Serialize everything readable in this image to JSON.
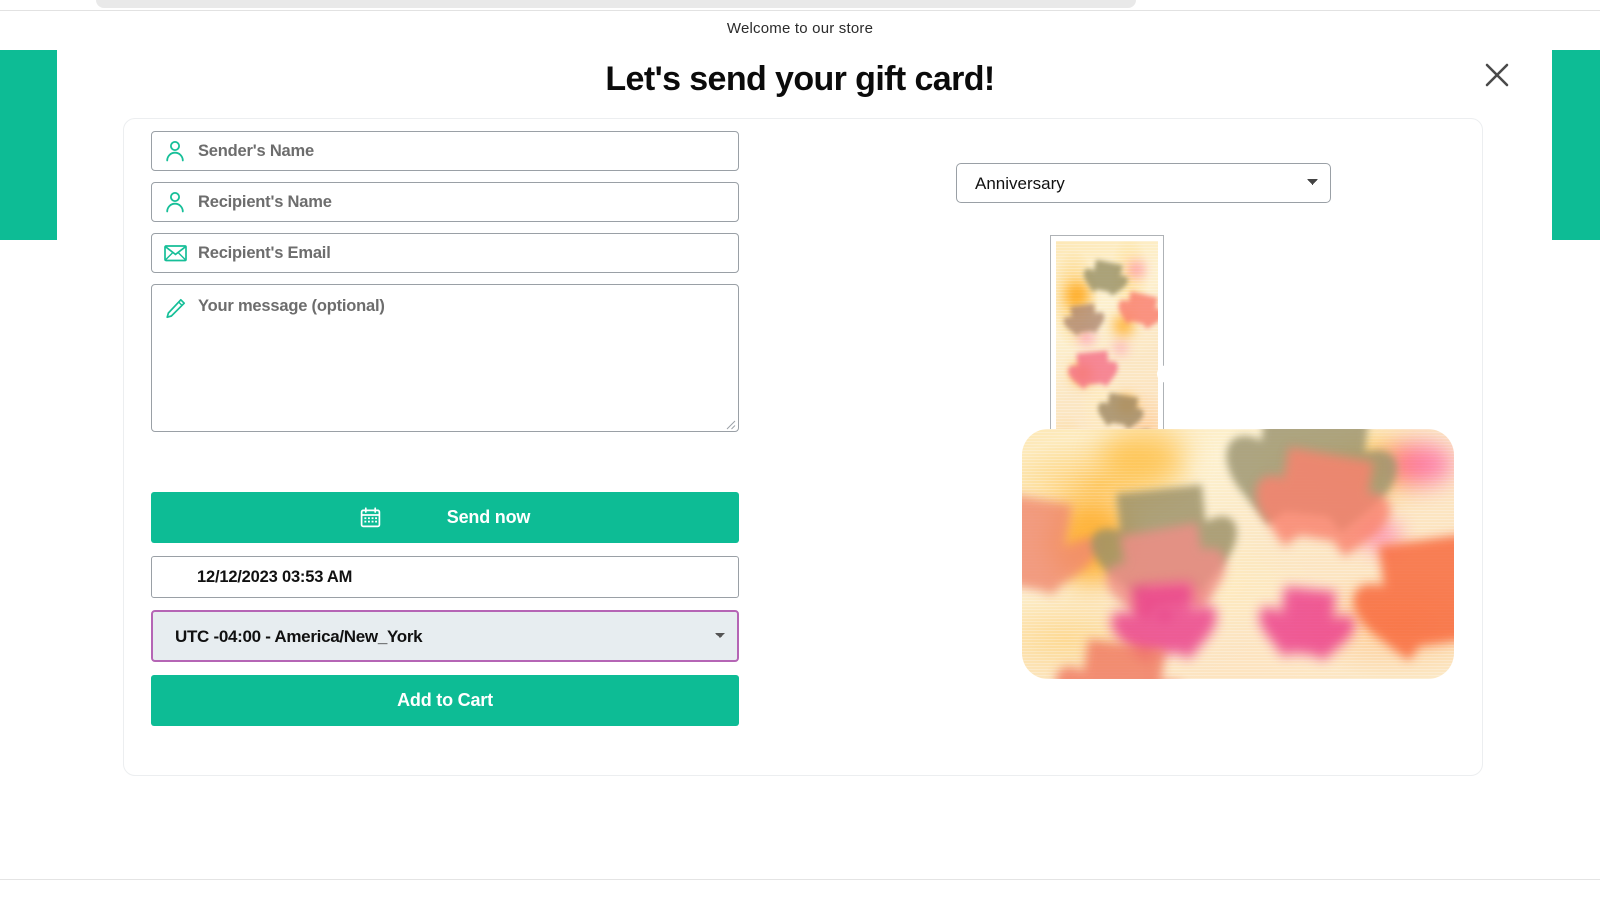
{
  "announcement": {
    "text": "Welcome to our store"
  },
  "modal": {
    "title": "Let's send your gift card!",
    "close_icon": "close-icon"
  },
  "form": {
    "sender_name": {
      "placeholder": "Sender's Name",
      "value": "",
      "icon": "user-icon"
    },
    "recipient_name": {
      "placeholder": "Recipient's Name",
      "value": "",
      "icon": "user-icon"
    },
    "recipient_email": {
      "placeholder": "Recipient's Email",
      "value": "",
      "icon": "envelope-icon"
    },
    "message": {
      "placeholder": "Your message (optional)",
      "value": "",
      "icon": "pencil-icon"
    },
    "send_now_button": {
      "label": "Send now",
      "icon": "calendar-icon"
    },
    "datetime": {
      "value": "12/12/2023 03:53 AM"
    },
    "timezone": {
      "selected": "UTC -04:00 - America/New_York",
      "options": [
        "UTC -04:00 - America/New_York"
      ]
    },
    "add_to_cart_button": {
      "label": "Add to Cart"
    }
  },
  "preview": {
    "occasion": {
      "selected": "Anniversary",
      "options": [
        "Anniversary"
      ]
    },
    "thumbnail": {
      "name": "watercolor-hearts-design",
      "selected": true
    },
    "large_card": {
      "name": "watercolor-hearts-design-large"
    }
  },
  "colors": {
    "brand_green": "#0dbc95",
    "purple_border": "#b565b5",
    "select_bg": "#e7edf0",
    "field_border": "#9aa0a6",
    "placeholder_text": "#6d6d6d",
    "title_text": "#0b0b0b"
  }
}
